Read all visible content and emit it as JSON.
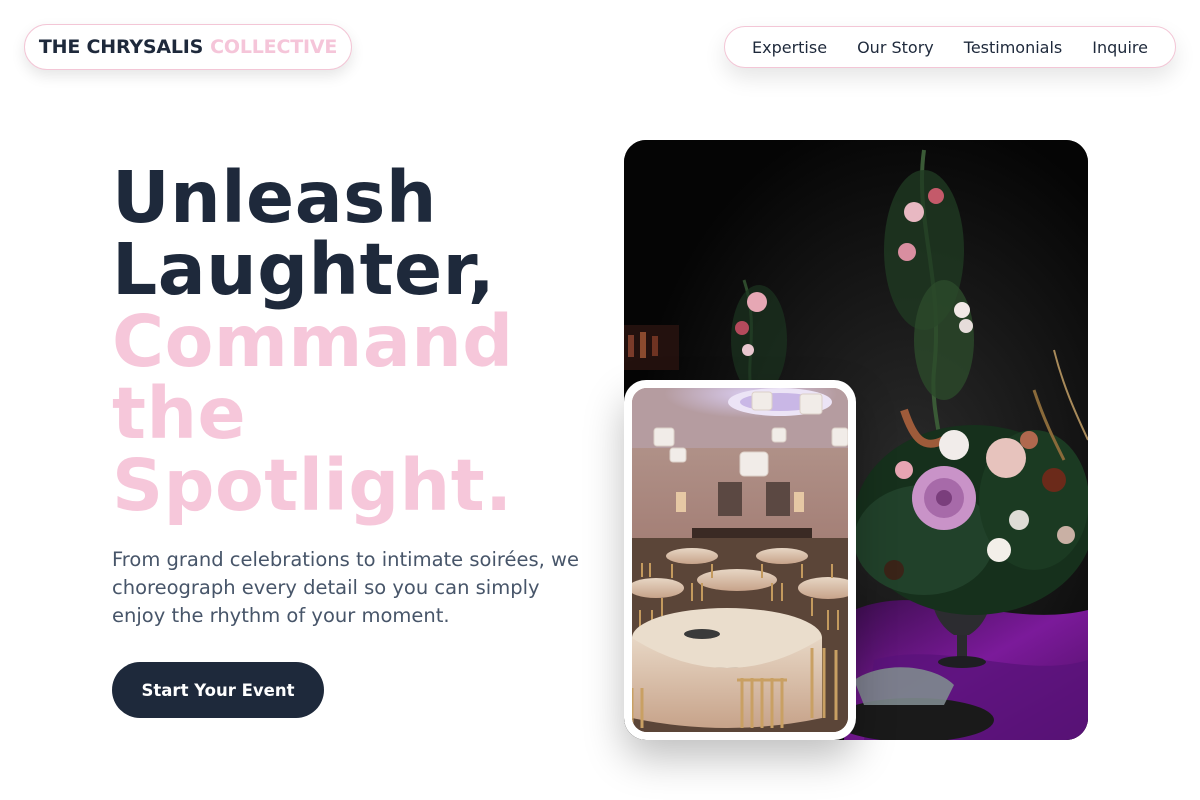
{
  "brand": {
    "name_dark": "THE CHRYSALIS",
    "name_pink": "COLLECTIVE"
  },
  "nav": {
    "items": [
      "Expertise",
      "Our Story",
      "Testimonials",
      "Inquire"
    ]
  },
  "hero": {
    "headline_dark": [
      "Unleash",
      "Laughter,"
    ],
    "headline_pink": [
      "Command",
      "the",
      "Spotlight."
    ],
    "subtitle": "From grand celebrations to intimate soirées, we choreograph every detail so you can simply enjoy the rhythm of your moment.",
    "cta_label": "Start Your Event"
  },
  "images": {
    "main": "floral-centerpiece-photo",
    "inset": "ballroom-tables-photo"
  },
  "colors": {
    "navy": "#1e293b",
    "pink": "#f6c7da",
    "border_pink": "#f3c6d6",
    "body_text": "#475569"
  }
}
